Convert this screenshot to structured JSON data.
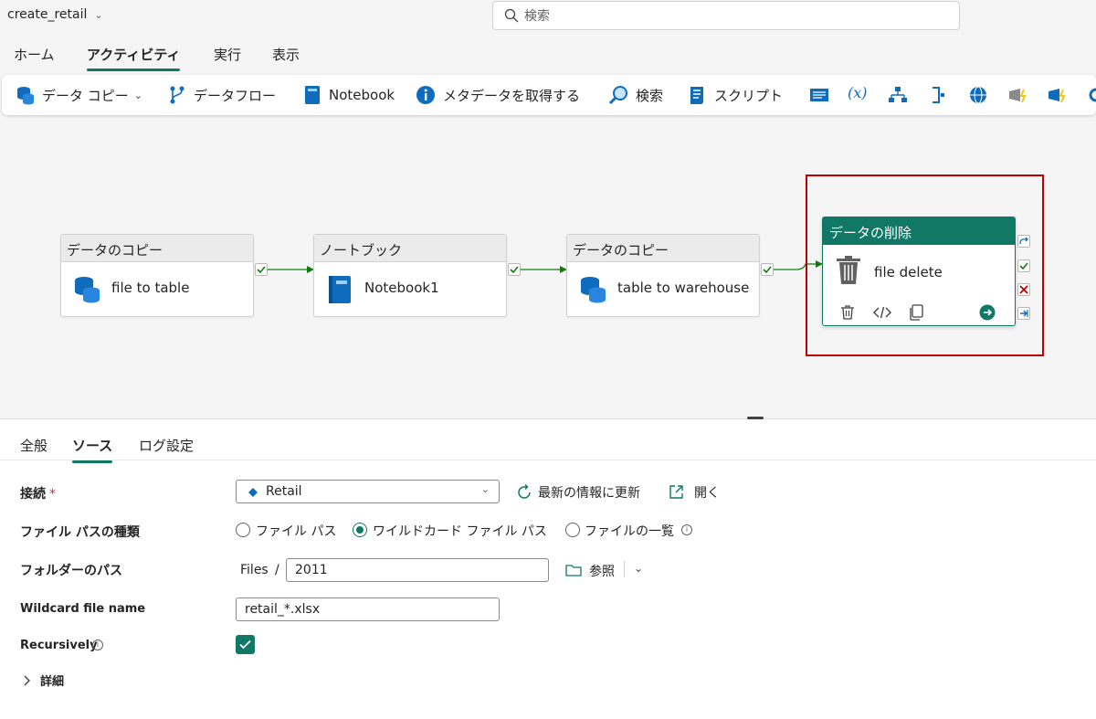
{
  "app": {
    "title": "create_retail"
  },
  "search": {
    "placeholder": "検索"
  },
  "menu_tabs": [
    "ホーム",
    "アクティビティ",
    "実行",
    "表示"
  ],
  "ribbon": {
    "copy_data": "データ コピー",
    "dataflow": "データフロー",
    "notebook": "Notebook",
    "get_metadata": "メタデータを取得する",
    "lookup": "検索",
    "script": "スクリプト",
    "variable_icon_text": "(x)"
  },
  "pipeline": {
    "nodes": [
      {
        "type": "データのコピー",
        "name": "file to table"
      },
      {
        "type": "ノートブック",
        "name": "Notebook1"
      },
      {
        "type": "データのコピー",
        "name": "table to warehouse"
      }
    ],
    "selected_node": {
      "type": "データの削除",
      "name": "file delete"
    }
  },
  "panel": {
    "tabs": [
      "全般",
      "ソース",
      "ログ設定"
    ],
    "connection": {
      "label": "接続",
      "required_mark": "*",
      "value": "Retail",
      "refresh": "最新の情報に更新",
      "open": "開く"
    },
    "file_path_type": {
      "label": "ファイル パスの種類",
      "options": [
        "ファイル パス",
        "ワイルドカード ファイル パス",
        "ファイルの一覧"
      ],
      "selected": "ワイルドカード ファイル パス"
    },
    "folder_path": {
      "label": "フォルダーのパス",
      "root": "Files",
      "separator": "/",
      "value": "2011",
      "browse": "参照"
    },
    "wildcard_file_name": {
      "label": "Wildcard file name",
      "value": "retail_*.xlsx"
    },
    "recursively": {
      "label": "Recursively",
      "checked": true
    },
    "details": {
      "label": "詳細"
    }
  },
  "colors": {
    "accent": "#117865",
    "error": "#c00000",
    "success": "#107c10"
  }
}
